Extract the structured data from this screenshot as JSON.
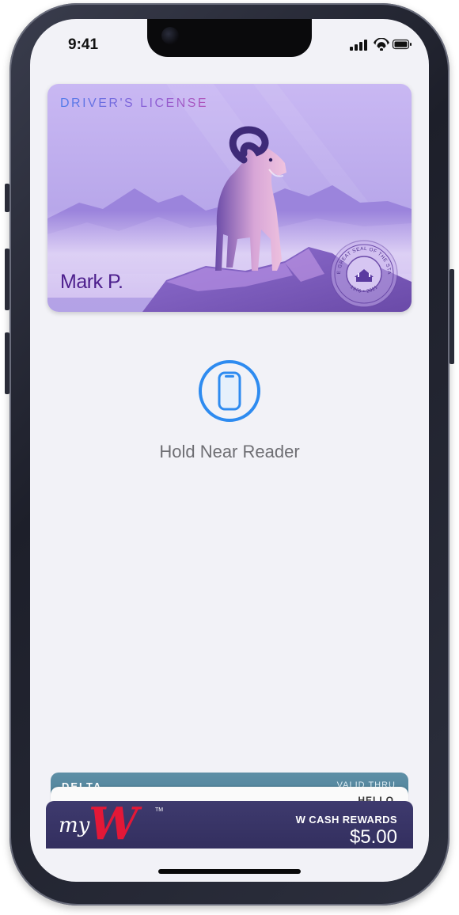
{
  "status_bar": {
    "time": "9:41",
    "icons": [
      "signal-icon",
      "wifi-icon",
      "battery-icon"
    ]
  },
  "license_card": {
    "title": "DRIVER'S LICENSE",
    "holder_name": "Mark P.",
    "seal_text": "THE GREAT SEAL OF THE STATE",
    "seal_years": "1976 • 2021",
    "colors": {
      "title_start": "#4f7bea",
      "title_end": "#b153b9",
      "holder": "#4d1f8d"
    }
  },
  "nfc_prompt": {
    "icon": "phone-reader-icon",
    "label": "Hold Near Reader",
    "accent": "#2e8bf0"
  },
  "passes": {
    "delta": {
      "name": "DELTA",
      "valid_label": "VALID THRU"
    },
    "white_pass": {
      "label": "HELLO"
    },
    "walgreens": {
      "logo_my": "my",
      "logo_w": "W",
      "tm": "TM",
      "rewards_label": "W CASH REWARDS",
      "rewards_amount": "$5.00"
    }
  }
}
